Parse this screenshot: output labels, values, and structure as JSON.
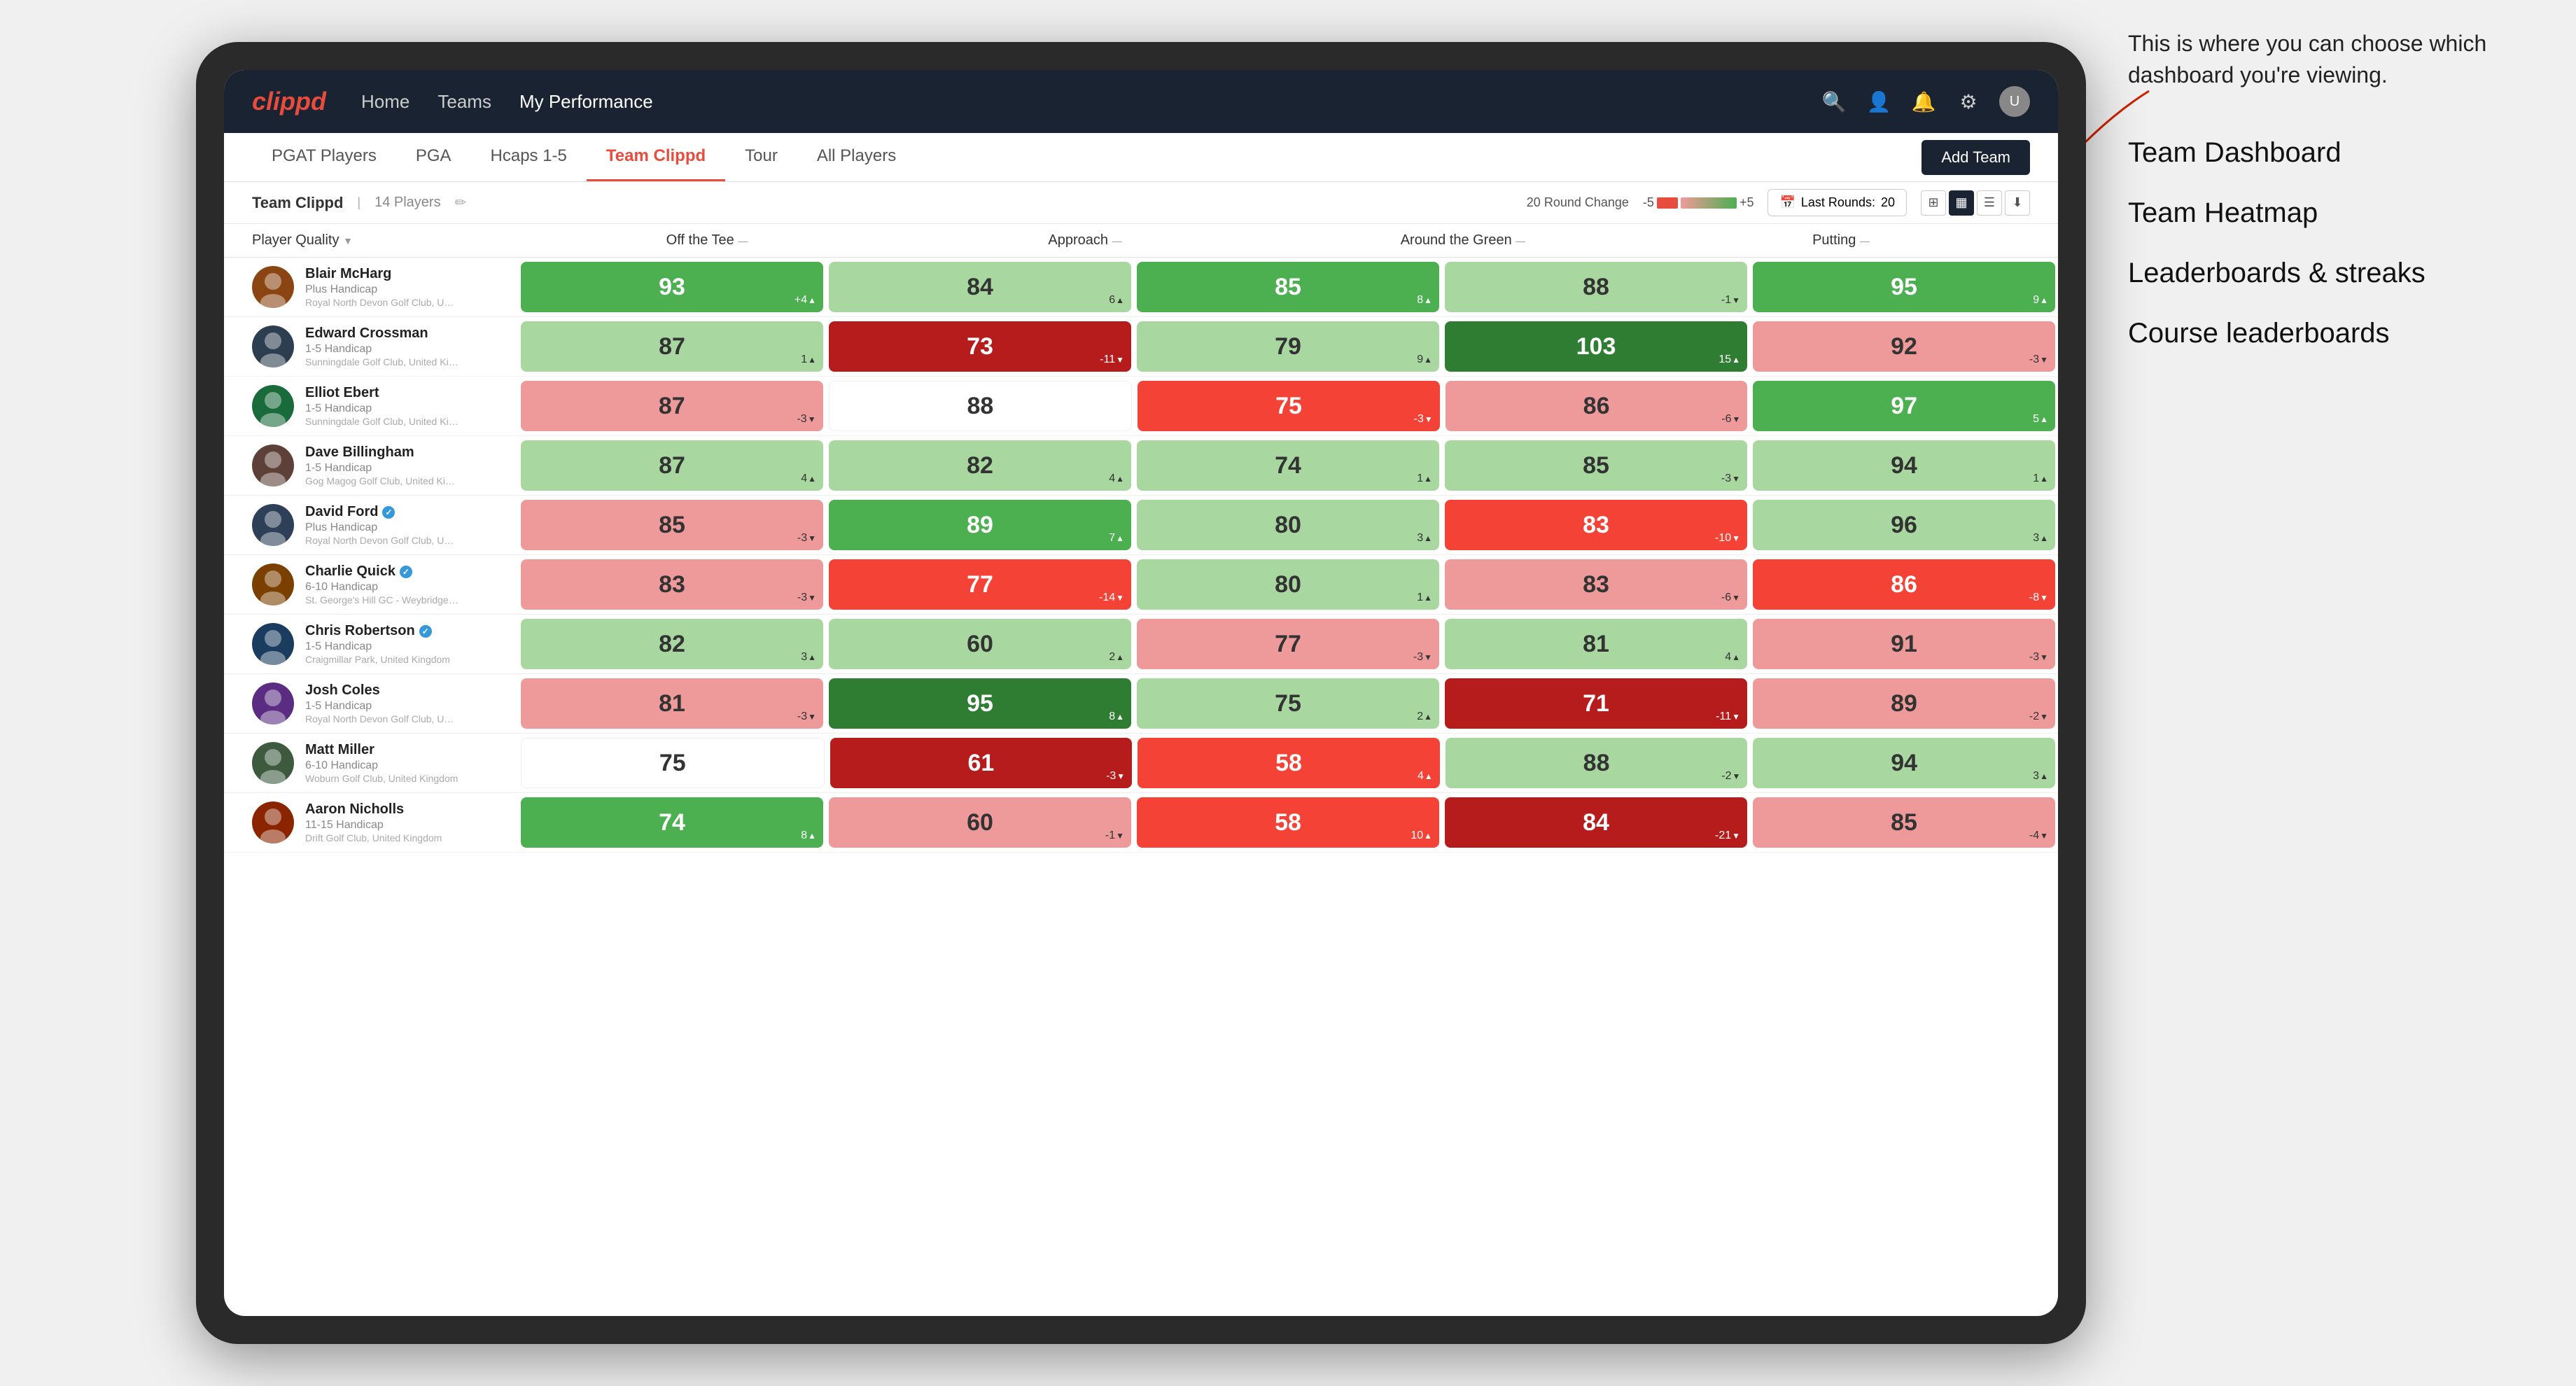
{
  "annotation": {
    "intro": "This is where you can choose which dashboard you're viewing.",
    "options": [
      "Team Dashboard",
      "Team Heatmap",
      "Leaderboards & streaks",
      "Course leaderboards"
    ]
  },
  "topNav": {
    "logo": "clippd",
    "links": [
      "Home",
      "Teams",
      "My Performance"
    ],
    "activeLink": "My Performance"
  },
  "subNav": {
    "links": [
      "PGAT Players",
      "PGA",
      "Hcaps 1-5",
      "Team Clippd",
      "Tour",
      "All Players"
    ],
    "activeLink": "Team Clippd",
    "addTeamLabel": "Add Team"
  },
  "teamHeader": {
    "name": "Team Clippd",
    "playerCount": "14 Players",
    "roundChangeLabel": "20 Round Change",
    "legendNeg": "-5",
    "legendPos": "+5",
    "lastRoundsLabel": "Last Rounds:",
    "lastRoundsValue": "20"
  },
  "tableHeaders": {
    "playerQuality": "Player Quality",
    "offTee": "Off the Tee",
    "approach": "Approach",
    "aroundGreen": "Around the Green",
    "putting": "Putting"
  },
  "players": [
    {
      "name": "Blair McHarg",
      "handicap": "Plus Handicap",
      "club": "Royal North Devon Golf Club, United Kingdom",
      "verified": false,
      "scores": [
        {
          "value": 93,
          "change": "+4",
          "dir": "up",
          "color": "green"
        },
        {
          "value": 84,
          "change": "6",
          "dir": "up",
          "color": "light-green"
        },
        {
          "value": 85,
          "change": "8",
          "dir": "up",
          "color": "green"
        },
        {
          "value": 88,
          "change": "-1",
          "dir": "down",
          "color": "light-green"
        },
        {
          "value": 95,
          "change": "9",
          "dir": "up",
          "color": "green"
        }
      ]
    },
    {
      "name": "Edward Crossman",
      "handicap": "1-5 Handicap",
      "club": "Sunningdale Golf Club, United Kingdom",
      "verified": false,
      "scores": [
        {
          "value": 87,
          "change": "1",
          "dir": "up",
          "color": "light-green"
        },
        {
          "value": 73,
          "change": "-11",
          "dir": "down",
          "color": "dark-red"
        },
        {
          "value": 79,
          "change": "9",
          "dir": "up",
          "color": "light-green"
        },
        {
          "value": 103,
          "change": "15",
          "dir": "up",
          "color": "dark-green"
        },
        {
          "value": 92,
          "change": "-3",
          "dir": "down",
          "color": "light-red"
        }
      ]
    },
    {
      "name": "Elliot Ebert",
      "handicap": "1-5 Handicap",
      "club": "Sunningdale Golf Club, United Kingdom",
      "verified": false,
      "scores": [
        {
          "value": 87,
          "change": "-3",
          "dir": "down",
          "color": "light-red"
        },
        {
          "value": 88,
          "change": "",
          "dir": "",
          "color": "white"
        },
        {
          "value": 75,
          "change": "-3",
          "dir": "down",
          "color": "red"
        },
        {
          "value": 86,
          "change": "-6",
          "dir": "down",
          "color": "light-red"
        },
        {
          "value": 97,
          "change": "5",
          "dir": "up",
          "color": "green"
        }
      ]
    },
    {
      "name": "Dave Billingham",
      "handicap": "1-5 Handicap",
      "club": "Gog Magog Golf Club, United Kingdom",
      "verified": false,
      "scores": [
        {
          "value": 87,
          "change": "4",
          "dir": "up",
          "color": "light-green"
        },
        {
          "value": 82,
          "change": "4",
          "dir": "up",
          "color": "light-green"
        },
        {
          "value": 74,
          "change": "1",
          "dir": "up",
          "color": "light-green"
        },
        {
          "value": 85,
          "change": "-3",
          "dir": "down",
          "color": "light-green"
        },
        {
          "value": 94,
          "change": "1",
          "dir": "up",
          "color": "light-green"
        }
      ]
    },
    {
      "name": "David Ford",
      "handicap": "Plus Handicap",
      "club": "Royal North Devon Golf Club, United Kingdom",
      "verified": true,
      "scores": [
        {
          "value": 85,
          "change": "-3",
          "dir": "down",
          "color": "light-red"
        },
        {
          "value": 89,
          "change": "7",
          "dir": "up",
          "color": "green"
        },
        {
          "value": 80,
          "change": "3",
          "dir": "up",
          "color": "light-green"
        },
        {
          "value": 83,
          "change": "-10",
          "dir": "down",
          "color": "red"
        },
        {
          "value": 96,
          "change": "3",
          "dir": "up",
          "color": "light-green"
        }
      ]
    },
    {
      "name": "Charlie Quick",
      "handicap": "6-10 Handicap",
      "club": "St. George's Hill GC - Weybridge - Surrey, Uni...",
      "verified": true,
      "scores": [
        {
          "value": 83,
          "change": "-3",
          "dir": "down",
          "color": "light-red"
        },
        {
          "value": 77,
          "change": "-14",
          "dir": "down",
          "color": "red"
        },
        {
          "value": 80,
          "change": "1",
          "dir": "up",
          "color": "light-green"
        },
        {
          "value": 83,
          "change": "-6",
          "dir": "down",
          "color": "light-red"
        },
        {
          "value": 86,
          "change": "-8",
          "dir": "down",
          "color": "red"
        }
      ]
    },
    {
      "name": "Chris Robertson",
      "handicap": "1-5 Handicap",
      "club": "Craigmillar Park, United Kingdom",
      "verified": true,
      "scores": [
        {
          "value": 82,
          "change": "3",
          "dir": "up",
          "color": "light-green"
        },
        {
          "value": 60,
          "change": "2",
          "dir": "up",
          "color": "light-green"
        },
        {
          "value": 77,
          "change": "-3",
          "dir": "down",
          "color": "light-red"
        },
        {
          "value": 81,
          "change": "4",
          "dir": "up",
          "color": "light-green"
        },
        {
          "value": 91,
          "change": "-3",
          "dir": "down",
          "color": "light-red"
        }
      ]
    },
    {
      "name": "Josh Coles",
      "handicap": "1-5 Handicap",
      "club": "Royal North Devon Golf Club, United Kingdom",
      "verified": false,
      "scores": [
        {
          "value": 81,
          "change": "-3",
          "dir": "down",
          "color": "light-red"
        },
        {
          "value": 95,
          "change": "8",
          "dir": "up",
          "color": "dark-green"
        },
        {
          "value": 75,
          "change": "2",
          "dir": "up",
          "color": "light-green"
        },
        {
          "value": 71,
          "change": "-11",
          "dir": "down",
          "color": "dark-red"
        },
        {
          "value": 89,
          "change": "-2",
          "dir": "down",
          "color": "light-red"
        }
      ]
    },
    {
      "name": "Matt Miller",
      "handicap": "6-10 Handicap",
      "club": "Woburn Golf Club, United Kingdom",
      "verified": false,
      "scores": [
        {
          "value": 75,
          "change": "",
          "dir": "",
          "color": "white"
        },
        {
          "value": 61,
          "change": "-3",
          "dir": "down",
          "color": "dark-red"
        },
        {
          "value": 58,
          "change": "4",
          "dir": "up",
          "color": "red"
        },
        {
          "value": 88,
          "change": "-2",
          "dir": "down",
          "color": "light-green"
        },
        {
          "value": 94,
          "change": "3",
          "dir": "up",
          "color": "light-green"
        }
      ]
    },
    {
      "name": "Aaron Nicholls",
      "handicap": "11-15 Handicap",
      "club": "Drift Golf Club, United Kingdom",
      "verified": false,
      "scores": [
        {
          "value": 74,
          "change": "8",
          "dir": "up",
          "color": "green"
        },
        {
          "value": 60,
          "change": "-1",
          "dir": "down",
          "color": "light-red"
        },
        {
          "value": 58,
          "change": "10",
          "dir": "up",
          "color": "red"
        },
        {
          "value": 84,
          "change": "-21",
          "dir": "down",
          "color": "dark-red"
        },
        {
          "value": 85,
          "change": "-4",
          "dir": "down",
          "color": "light-red"
        }
      ]
    }
  ]
}
